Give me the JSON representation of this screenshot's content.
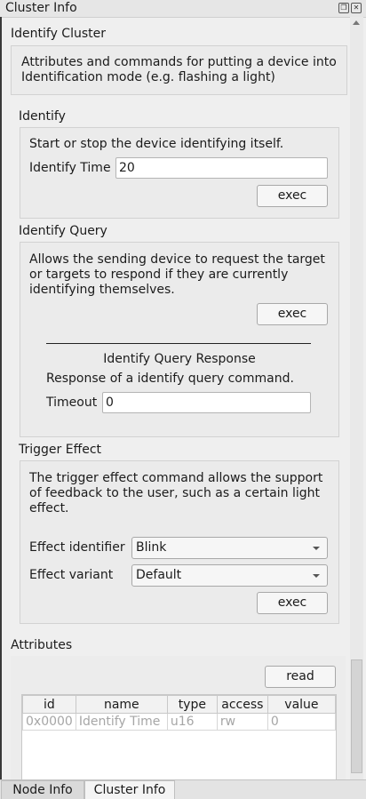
{
  "window": {
    "title": "Cluster Info"
  },
  "cluster": {
    "title": "Identify Cluster",
    "description_line1": "Attributes and commands for putting a device into",
    "description_line2": "Identification mode (e.g. flashing a light)"
  },
  "identify": {
    "title": "Identify",
    "description": "Start or stop the device identifying itself.",
    "time_label": "Identify Time",
    "time_value": "20",
    "exec_label": "exec"
  },
  "identify_query": {
    "title": "Identify Query",
    "description_line1": "Allows the sending device to request the target",
    "description_line2": "or targets to respond if they are currently",
    "description_line3": "identifying themselves.",
    "exec_label": "exec",
    "response_title": "Identify Query Response",
    "response_description": "Response of a identify query command.",
    "timeout_label": "Timeout",
    "timeout_value": "0"
  },
  "trigger_effect": {
    "title": "Trigger Effect",
    "description_line1": "The trigger effect command allows the support",
    "description_line2": "of feedback to the user, such as a certain light",
    "description_line3": "effect.",
    "effect_identifier_label": "Effect identifier",
    "effect_identifier_value": "Blink",
    "effect_variant_label": "Effect variant",
    "effect_variant_value": "Default",
    "exec_label": "exec"
  },
  "attributes": {
    "title": "Attributes",
    "read_label": "read",
    "columns": [
      "id",
      "name",
      "type",
      "access",
      "value"
    ],
    "rows": [
      [
        "0x0000",
        "Identify Time",
        "u16",
        "rw",
        "0"
      ]
    ]
  },
  "tabs": [
    "Node Info",
    "Cluster Info"
  ],
  "icons": [
    "restore-icon",
    "close-icon",
    "scroll-up-icon",
    "scroll-down-icon",
    "chevron-down-icon"
  ]
}
